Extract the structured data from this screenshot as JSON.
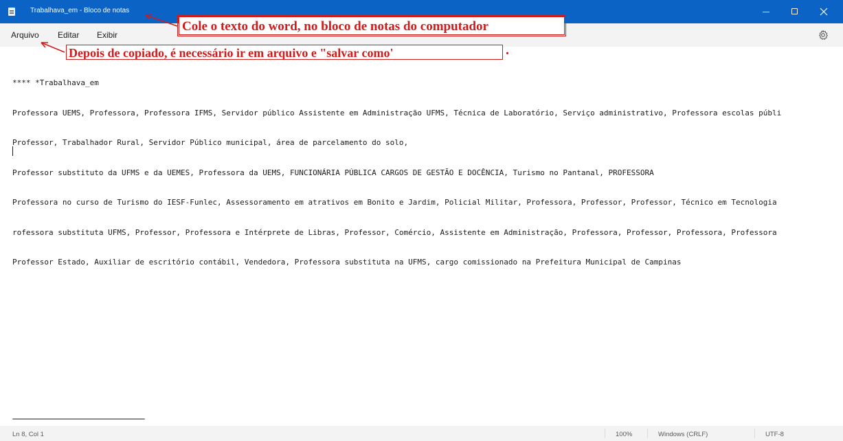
{
  "window": {
    "title": "Trabalhava_em - Bloco de notas",
    "app_icon": "notepad-icon",
    "controls": [
      "minimize-icon",
      "maximize-icon",
      "close-icon"
    ]
  },
  "menu": {
    "items": [
      {
        "label": "Arquivo"
      },
      {
        "label": "Editar"
      },
      {
        "label": "Exibir"
      }
    ],
    "settings_icon": "gear-icon"
  },
  "annotations": {
    "top": "Cole o texto do word, no bloco de notas do computador",
    "bottom": "Depois de copiado, é necessário ir em arquivo e \"salvar como'",
    "trailing_dot": ".",
    "color": "#d11a1a"
  },
  "editor": {
    "lines": [
      "**** *Trabalhava_em",
      "Professora UEMS, Professora, Professora IFMS, Servidor público Assistente em Administração UFMS, Técnica de Laboratório, Serviço administrativo, Professora escolas públi",
      "Professor, Trabalhador Rural, Servidor Público municipal, área de parcelamento do solo,",
      "Professor substituto da UFMS e da UEMES, Professora da UEMS, FUNCIONÁRIA PÚBLICA CARGOS DE GESTÃO E DOCÊNCIA, Turismo no Pantanal, PROFESSORA",
      "Professora no curso de Turismo do IESF-Funlec, Assessoramento em atrativos em Bonito e Jardim, Policial Militar, Professora, Professor, Professor, Técnico em Tecnologia",
      "rofessora substituta UFMS, Professor, Professora e Intérprete de Libras, Professor, Comércio, Assistente em Administração, Professora, Professor, Professora, Professora",
      "Professor Estado, Auxiliar de escritório contábil, Vendedora, Professora substituta na UFMS, cargo comissionado na Prefeitura Municipal de Campinas"
    ]
  },
  "status": {
    "position": "Ln 8, Col 1",
    "zoom": "100%",
    "line_ending": "Windows (CRLF)",
    "encoding": "UTF-8"
  },
  "colors": {
    "titlebar": "#0b63c6",
    "menubar": "#f3f3f3",
    "annotation": "#d11a1a"
  }
}
